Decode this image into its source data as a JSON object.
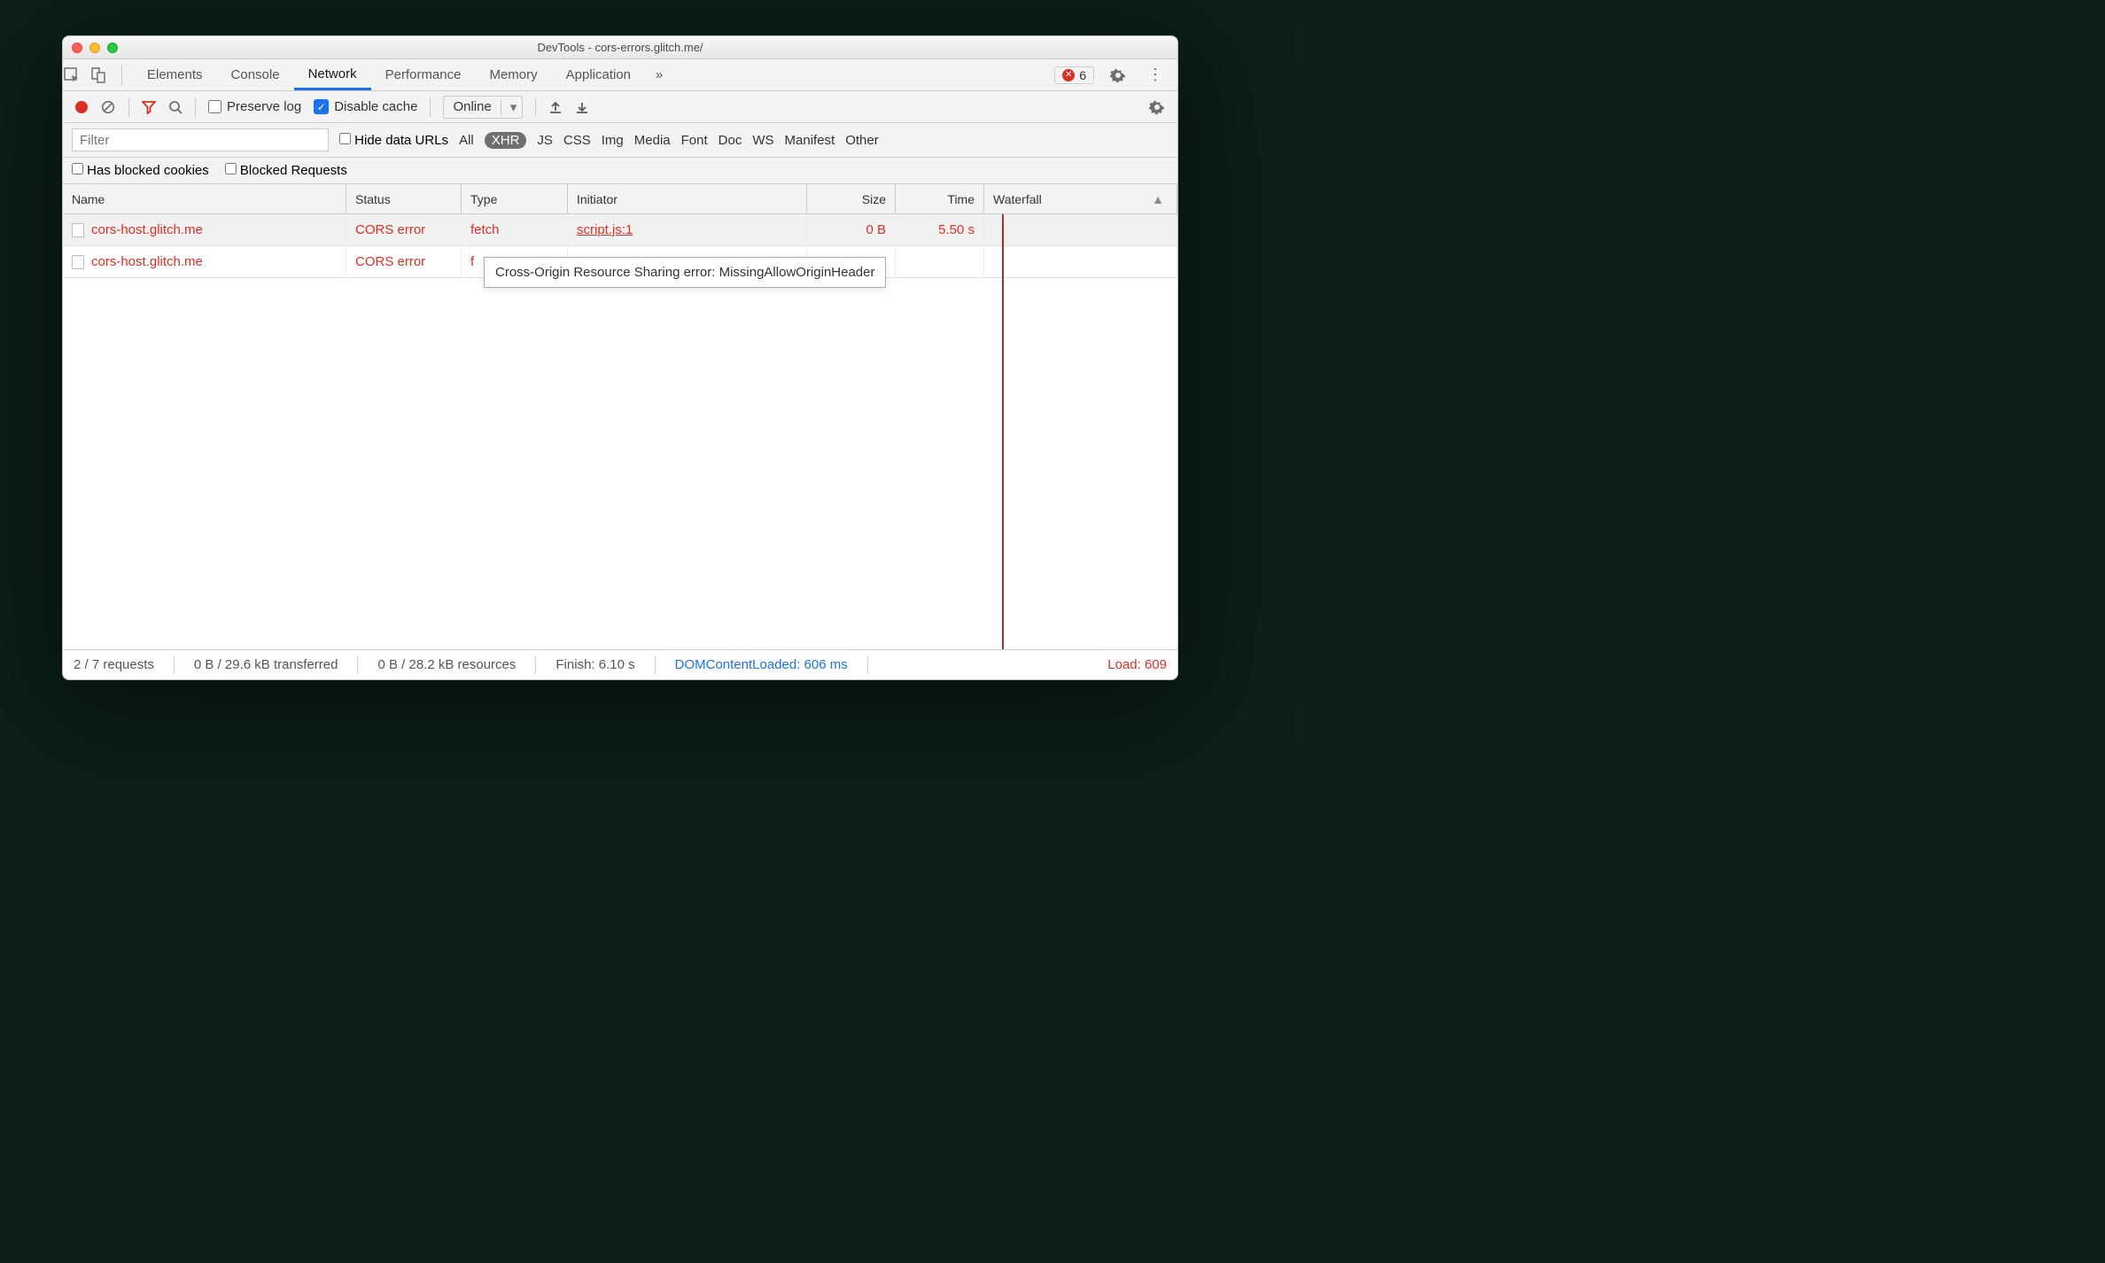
{
  "window": {
    "title": "DevTools - cors-errors.glitch.me/"
  },
  "tabbar": {
    "tabs": [
      "Elements",
      "Console",
      "Network",
      "Performance",
      "Memory",
      "Application"
    ],
    "active_index": 2,
    "overflow_glyph": "»",
    "error_count": "6"
  },
  "toolbar": {
    "preserve_log_label": "Preserve log",
    "disable_cache_label": "Disable cache",
    "throttling_label": "Online"
  },
  "filter": {
    "placeholder": "Filter",
    "hide_data_urls_label": "Hide data URLs",
    "types": [
      "All",
      "XHR",
      "JS",
      "CSS",
      "Img",
      "Media",
      "Font",
      "Doc",
      "WS",
      "Manifest",
      "Other"
    ],
    "selected_type_index": 1,
    "has_blocked_cookies_label": "Has blocked cookies",
    "blocked_requests_label": "Blocked Requests"
  },
  "headers": {
    "name": "Name",
    "status": "Status",
    "type": "Type",
    "initiator": "Initiator",
    "size": "Size",
    "time": "Time",
    "waterfall": "Waterfall"
  },
  "rows": [
    {
      "name": "cors-host.glitch.me",
      "status": "CORS error",
      "type": "fetch",
      "initiator": "script.js:1",
      "size": "0 B",
      "time": "5.50 s",
      "hovered": true
    },
    {
      "name": "cors-host.glitch.me",
      "status": "CORS error",
      "type": "f",
      "initiator": "",
      "size": "",
      "time": "",
      "hovered": false
    }
  ],
  "tooltip": {
    "text": "Cross-Origin Resource Sharing error: MissingAllowOriginHeader"
  },
  "statusbar": {
    "requests": "2 / 7 requests",
    "transferred": "0 B / 29.6 kB transferred",
    "resources": "0 B / 28.2 kB resources",
    "finish": "Finish: 6.10 s",
    "dcl": "DOMContentLoaded: 606 ms",
    "load": "Load: 609"
  }
}
